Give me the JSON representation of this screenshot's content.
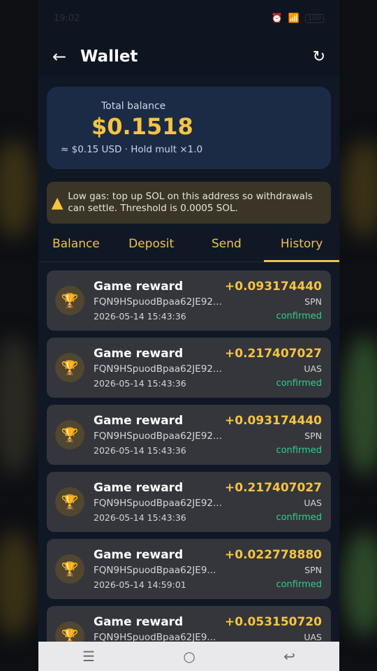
{
  "status_bar": {
    "time": "19:02",
    "battery": "100"
  },
  "header": {
    "title": "Wallet"
  },
  "balance": {
    "label": "Total balance",
    "value": "$0.1518",
    "sub": "≈ $0.15 USD · Hold mult ×1.0"
  },
  "warning": {
    "text": "Low gas: top up SOL on this address so withdrawals can settle. Threshold is 0.0005 SOL."
  },
  "tabs": [
    "Balance",
    "Deposit",
    "Send",
    "History"
  ],
  "active_tab": "History",
  "history": [
    {
      "title": "Game reward",
      "address": "FQN9HSpuodBpaa62JE92...",
      "date": "2026-05-14 15:43:36",
      "amount": "+0.093174440",
      "token": "SPN",
      "status": "confirmed"
    },
    {
      "title": "Game reward",
      "address": "FQN9HSpuodBpaa62JE92...",
      "date": "2026-05-14 15:43:36",
      "amount": "+0.217407027",
      "token": "UAS",
      "status": "confirmed"
    },
    {
      "title": "Game reward",
      "address": "FQN9HSpuodBpaa62JE92...",
      "date": "2026-05-14 15:43:36",
      "amount": "+0.093174440",
      "token": "SPN",
      "status": "confirmed"
    },
    {
      "title": "Game reward",
      "address": "FQN9HSpuodBpaa62JE92...",
      "date": "2026-05-14 15:43:36",
      "amount": "+0.217407027",
      "token": "UAS",
      "status": "confirmed"
    },
    {
      "title": "Game reward",
      "address": "FQN9HSpuodBpaa62JE9...",
      "date": "2026-05-14 14:59:01",
      "amount": "+0.022778880",
      "token": "SPN",
      "status": "confirmed"
    },
    {
      "title": "Game reward",
      "address": "FQN9HSpuodBpaa62JE9...",
      "date": "",
      "amount": "+0.053150720",
      "token": "UAS",
      "status": ""
    }
  ],
  "icons": {
    "back": "arrow-left-icon",
    "refresh": "refresh-icon",
    "warning": "warning-triangle-icon",
    "trophy": "trophy-icon"
  },
  "colors": {
    "accent": "#f6c441",
    "success": "#2fd08a",
    "card": "#1c2b45"
  }
}
